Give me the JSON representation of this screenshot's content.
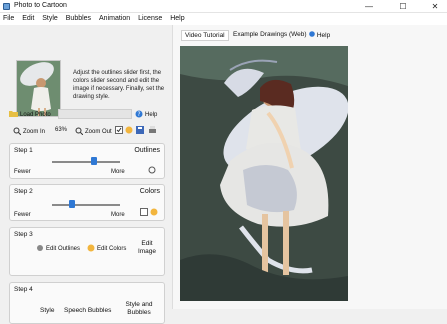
{
  "window": {
    "title": "Photo to Cartoon",
    "controls": [
      "—",
      "☐",
      "✕"
    ]
  },
  "menu": [
    "File",
    "Edit",
    "Style",
    "Bubbles",
    "Animation",
    "License",
    "Help"
  ],
  "instructions": "Adjust the outlines slider first, the colors slider second and edit the image if necessary. Finally, set the drawing style.",
  "toolbar": {
    "load_photo": "Load Photo",
    "help": "Help",
    "zoom_in": "Zoom In",
    "zoom_value": "63%",
    "zoom_out": "Zoom Out"
  },
  "steps": [
    {
      "label": "Step 1",
      "title": "Outlines",
      "left": "Fewer",
      "right": "More",
      "value": 0.62
    },
    {
      "label": "Step 2",
      "title": "Colors",
      "left": "Fewer",
      "right": "More",
      "value": 0.29
    },
    {
      "label": "Step 3",
      "btn1": "Edit Outlines",
      "btn2": "Edit Colors",
      "btn3": "Edit Image"
    },
    {
      "label": "Step 4",
      "btn1": "Style",
      "btn2": "Speech Bubbles",
      "btn3": "Style and Bubbles"
    }
  ],
  "tabs": [
    "Video Tutorial",
    "Example Drawings (Web)",
    "Help"
  ],
  "colors": {
    "accent": "#2f78d4",
    "preview_bg": "#3d4a43",
    "preview_frame": "#d9d9d9"
  },
  "icons": {
    "load_photo": "folder-icon",
    "help": "help-icon",
    "zoom_in": "zoom-in-icon",
    "zoom_out": "zoom-out-icon",
    "check": "checkbox-icon",
    "save": "save-icon",
    "print": "print-icon",
    "edit_outlines": "pencil-icon",
    "edit_colors": "palette-icon"
  }
}
